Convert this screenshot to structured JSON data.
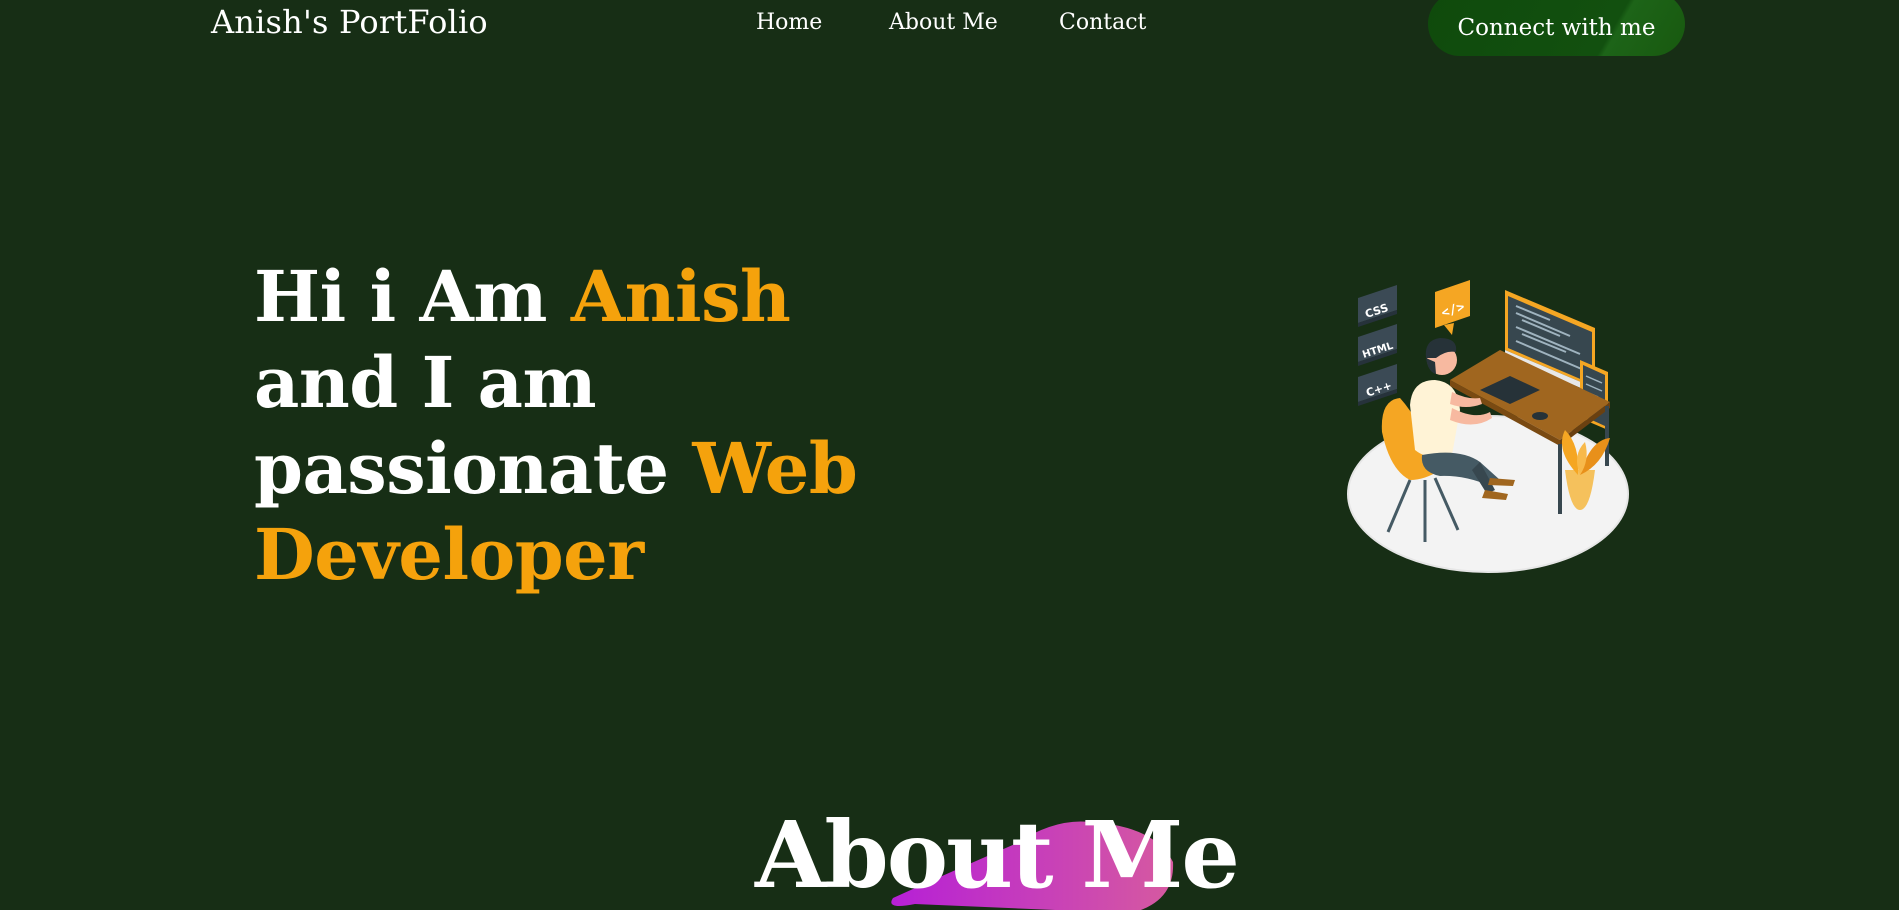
{
  "nav": {
    "brand": "Anish's PortFolio",
    "links": [
      "Home",
      "About Me",
      "Contact"
    ],
    "cta": "Connect with me"
  },
  "hero": {
    "line1_plain": "Hi i Am ",
    "line1_accent": "Anish",
    "line2": "and I am",
    "line3_plain": "passionate ",
    "line3_accent": "Web",
    "line4_accent": "Developer"
  },
  "illustration": {
    "tags": [
      "CSS",
      "HTML",
      "C++"
    ],
    "code_badge": "</>"
  },
  "about": {
    "title": "About Me"
  },
  "colors": {
    "background": "#172e15",
    "accent": "#f5a20c",
    "button": "#12500f",
    "blob": "#c13cc7"
  }
}
